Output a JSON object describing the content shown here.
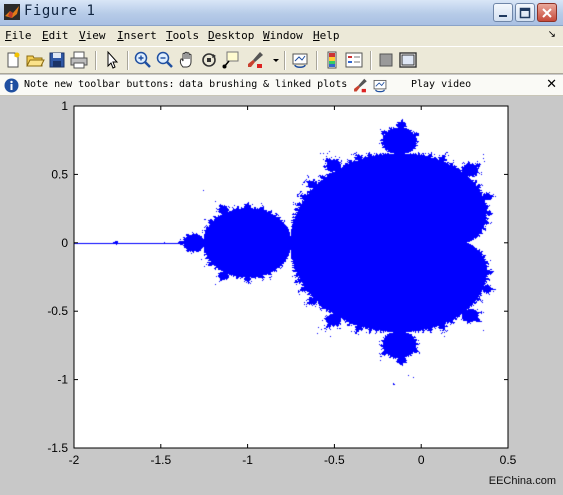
{
  "window": {
    "title": "Figure 1",
    "controls": {
      "minimize_icon": "minimize-icon",
      "maximize_icon": "maximize-icon",
      "close_icon": "close-icon"
    }
  },
  "menubar": {
    "items": [
      {
        "label": "File",
        "mnemonic": "F"
      },
      {
        "label": "Edit",
        "mnemonic": "E"
      },
      {
        "label": "View",
        "mnemonic": "V"
      },
      {
        "label": "Insert",
        "mnemonic": "I"
      },
      {
        "label": "Tools",
        "mnemonic": "T"
      },
      {
        "label": "Desktop",
        "mnemonic": "D"
      },
      {
        "label": "Window",
        "mnemonic": "W"
      },
      {
        "label": "Help",
        "mnemonic": "H"
      }
    ],
    "dock_arrow": "↘"
  },
  "toolbar": {
    "buttons": [
      "new-figure-icon",
      "open-file-icon",
      "save-icon",
      "print-icon",
      "edit-plot-arrow-icon",
      "zoom-in-icon",
      "zoom-out-icon",
      "pan-hand-icon",
      "rotate-3d-icon",
      "data-cursor-icon",
      "brush-icon",
      "link-plot-icon",
      "colorbar-icon",
      "legend-icon",
      "hide-plot-tools-icon",
      "show-plot-tools-icon"
    ]
  },
  "infobar": {
    "prefix": "Note new toolbar buttons:",
    "link_brushing": "data brushing",
    "amp": "&",
    "link_linked": "linked plots",
    "video_label": "Play video",
    "close_label": "✕"
  },
  "watermark": "EEChina.com",
  "colors": {
    "fill": "#0000ff",
    "axes_bg": "#ffffff",
    "figure_bg": "#c8c8c8"
  },
  "chart_data": {
    "type": "scatter",
    "title": "",
    "xlabel": "",
    "ylabel": "",
    "xlim": [
      -2,
      0.5
    ],
    "ylim": [
      -1.5,
      1
    ],
    "xticks": [
      -2,
      -1.5,
      -1,
      -0.5,
      0,
      0.5
    ],
    "xtick_labels": [
      "-2",
      "-1.5",
      "-1",
      "-0.5",
      "0",
      "0.5"
    ],
    "yticks": [
      -1.5,
      -1,
      -0.5,
      0,
      0.5,
      1
    ],
    "ytick_labels": [
      "-1.5",
      "-1",
      "-0.5",
      "0",
      "0.5",
      "1"
    ],
    "grid": false,
    "series": [
      {
        "kind": "mandelbrot-set",
        "max_iter": 60,
        "color": "#0000ff"
      }
    ]
  }
}
